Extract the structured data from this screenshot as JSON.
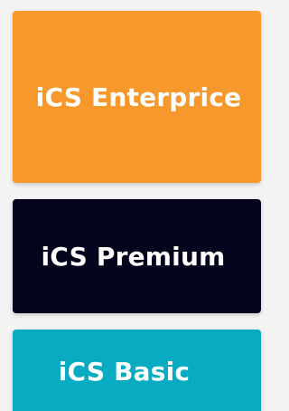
{
  "tiers": [
    {
      "label": "iCS Enterprice",
      "color": "#f7982c"
    },
    {
      "label": "iCS Premium",
      "color": "#05041d"
    },
    {
      "label": "iCS Basic",
      "color": "#07abc2"
    }
  ],
  "colors": {
    "page_background": "#f3f3f3",
    "label_text": "#ffffff"
  }
}
